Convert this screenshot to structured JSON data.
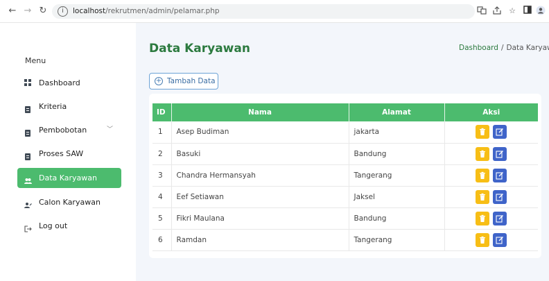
{
  "browser": {
    "url_host": "localhost",
    "url_path": "/rekrutmen/admin/pelamar.php",
    "icons": [
      "back-icon",
      "forward-icon",
      "reload-icon",
      "info-icon",
      "translate-icon",
      "share-icon",
      "star-icon",
      "sidepanel-icon",
      "profile-icon"
    ]
  },
  "sidebar": {
    "heading": "Menu",
    "items": [
      {
        "label": "Dashboard",
        "icon": "dashboard-icon"
      },
      {
        "label": "Kriteria",
        "icon": "document-icon"
      },
      {
        "label": "Pembobotan",
        "icon": "document-icon",
        "caret": "﹀"
      },
      {
        "label": "Proses SAW",
        "icon": "document-icon"
      },
      {
        "label": "Data Karyawan",
        "icon": "users-icon",
        "active": true
      },
      {
        "label": "Calon Karyawan",
        "icon": "user-edit-icon"
      },
      {
        "label": "Log out",
        "icon": "logout-icon"
      }
    ]
  },
  "main": {
    "title": "Data Karyawan",
    "breadcrumb": {
      "home": "Dashboard",
      "separator": "/",
      "current": "Data Karyawan"
    },
    "add_button": "Tambah Data",
    "table": {
      "headers": [
        "ID",
        "Nama",
        "Alamat",
        "Aksi"
      ],
      "rows": [
        {
          "id": "1",
          "nama": "Asep Budiman",
          "alamat": "jakarta"
        },
        {
          "id": "2",
          "nama": "Basuki",
          "alamat": "Bandung"
        },
        {
          "id": "3",
          "nama": "Chandra Hermansyah",
          "alamat": "Tangerang"
        },
        {
          "id": "4",
          "nama": "Eef Setiawan",
          "alamat": "Jaksel"
        },
        {
          "id": "5",
          "nama": "Fikri Maulana",
          "alamat": "Bandung"
        },
        {
          "id": "6",
          "nama": "Ramdan",
          "alamat": "Tangerang"
        }
      ]
    }
  },
  "colors": {
    "accent_green": "#4cbb6e",
    "title_green": "#2c7a3f",
    "delete_yellow": "#f7be16",
    "edit_blue": "#3f64c9",
    "main_bg": "#f3f6fb"
  }
}
